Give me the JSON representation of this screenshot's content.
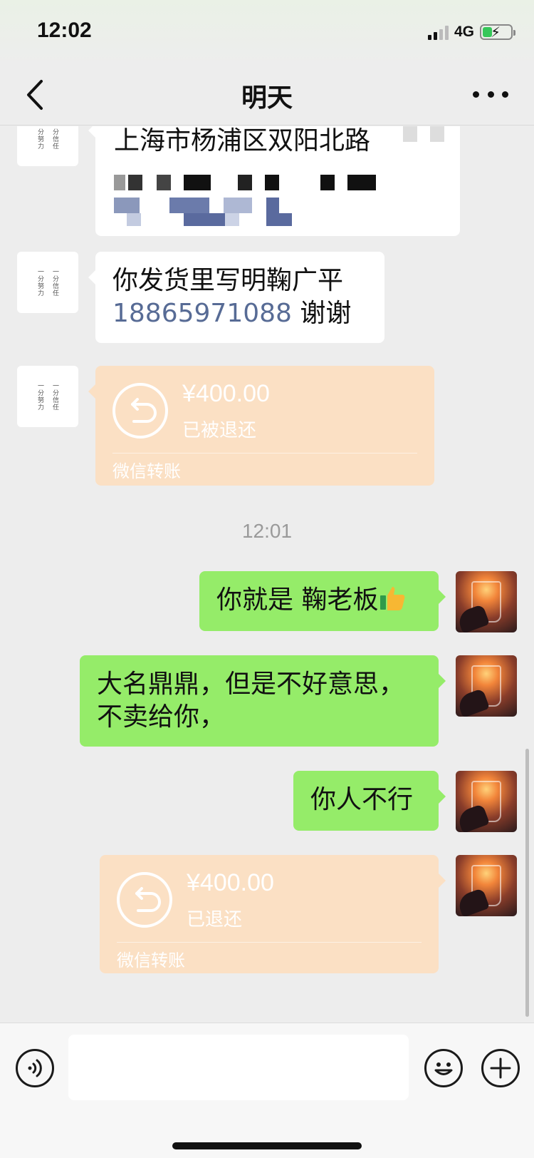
{
  "status_bar": {
    "time": "12:02",
    "network": "4G"
  },
  "header": {
    "title": "明天"
  },
  "contact_avatar": {
    "line1": "一分努力",
    "line2": "一分信任"
  },
  "messages": {
    "address": {
      "text": "上海市杨浦区双阳北路"
    },
    "shipping_note": {
      "line1": "你发货里写明鞠广平",
      "phone": "18865971088",
      "suffix": " 谢谢"
    },
    "transfer_in": {
      "amount": "¥400.00",
      "status": "已被退还",
      "label": "微信转账"
    },
    "time_divider": "12:01",
    "reply1": {
      "text": "你就是 鞠老板"
    },
    "reply2": {
      "line1": "大名鼎鼎，但是不好意思，",
      "line2": "不卖给你，"
    },
    "reply3": {
      "text": "你人不行"
    },
    "transfer_out": {
      "amount": "¥400.00",
      "status": "已退还",
      "label": "微信转账"
    }
  },
  "icons": {
    "back": "chevron-left-icon",
    "more": "more-dots-icon",
    "voice": "voice-icon",
    "emoji": "emoji-icon",
    "plus": "plus-icon",
    "refund": "refund-arrow-icon",
    "thumbs_up": "thumbs-up-emoji"
  },
  "colors": {
    "accent_green": "#95ec69",
    "transfer_bg": "#fbe0c4",
    "link_blue": "#576b95",
    "background": "#ededed"
  }
}
